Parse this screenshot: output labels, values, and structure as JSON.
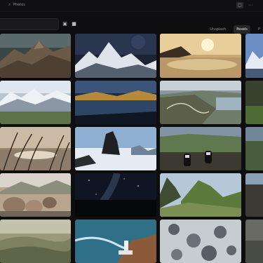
{
  "app": {
    "title": "Photos",
    "title_icon": "search-icon"
  },
  "titlebar": {
    "buttons": [
      {
        "name": "titlebar-tab-button",
        "glyph": "▢"
      },
      {
        "name": "titlebar-more-button",
        "glyph": "⋯"
      }
    ]
  },
  "toolbar": {
    "search_value": "",
    "search_placeholder": "",
    "icons": [
      {
        "name": "image-icon",
        "glyph": "▣"
      },
      {
        "name": "video-icon",
        "glyph": "■"
      }
    ],
    "sources": [
      {
        "label": "Unsplash",
        "active": false
      },
      {
        "label": "Pexels",
        "active": true
      },
      {
        "label": "P",
        "active": false
      }
    ]
  },
  "photos": [
    {
      "subject": "mountain ridge aerial"
    },
    {
      "subject": "snowy peaks under stars"
    },
    {
      "subject": "sunset over sea of clouds"
    },
    {
      "subject": "blue alpine peak"
    },
    {
      "subject": "snowy mountain range and green valley"
    },
    {
      "subject": "mountain lake at dusk"
    },
    {
      "subject": "winding road along coast"
    },
    {
      "subject": "green field"
    },
    {
      "subject": "grass silhouettes at sunset"
    },
    {
      "subject": "rock pinnacle above clouds"
    },
    {
      "subject": "hiker feet over valley"
    },
    {
      "subject": "green hills"
    },
    {
      "subject": "coastal boulders"
    },
    {
      "subject": "milky way over horizon"
    },
    {
      "subject": "green mountain peaks"
    },
    {
      "subject": "cliffs"
    },
    {
      "subject": "misty rolling hills"
    },
    {
      "subject": "lighthouse on rocky coast"
    },
    {
      "subject": "snow covered forest aerial"
    },
    {
      "subject": "cliff edge"
    }
  ]
}
